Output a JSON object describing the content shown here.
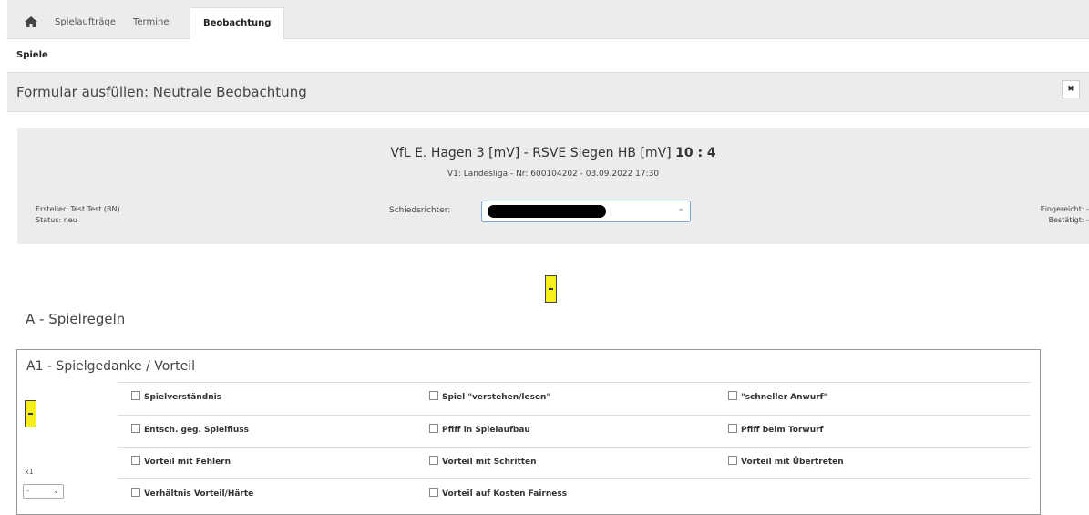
{
  "tabs": {
    "items": [
      {
        "label": "Spielaufträge"
      },
      {
        "label": "Termine"
      },
      {
        "label": "Beobachtung"
      }
    ]
  },
  "subnav": {
    "label": "Spiele"
  },
  "header": {
    "title": "Formular ausfüllen: Neutrale Beobachtung",
    "close_label": "✖"
  },
  "match": {
    "teams": "VfL E. Hagen 3 [mV] - RSVE Siegen HB [mV]",
    "score": "10 : 4",
    "meta": "V1: Landesliga - Nr: 600104202 - 03.09.2022 17:30",
    "creator": "Ersteller: Test Test (BN)",
    "status": "Status: neu",
    "referee_label": "Schiedsrichter:",
    "submitted": "Eingereicht: -",
    "confirmed": "Bestätigt: -"
  },
  "section": {
    "title": "A - Spielregeln"
  },
  "card": {
    "title": "A1 - Spielgedanke / Vorteil",
    "factor_label": "x1",
    "select_value": "-",
    "options": [
      "Spielverständnis",
      "Spiel \"verstehen/lesen\"",
      "\"schneller Anwurf\"",
      "Entsch. geg. Spielfluss",
      "Pfiff in Spielaufbau",
      "Pfiff beim Torwurf",
      "Vorteil mit Fehlern",
      "Vorteil mit Schritten",
      "Vorteil mit Übertreten",
      "Verhältnis Vorteil/Härte",
      "Vorteil auf Kosten Fairness"
    ]
  },
  "colors": {
    "highlight": "#f7ef1c",
    "panel": "#ececec",
    "accent": "#7aa7d8"
  }
}
